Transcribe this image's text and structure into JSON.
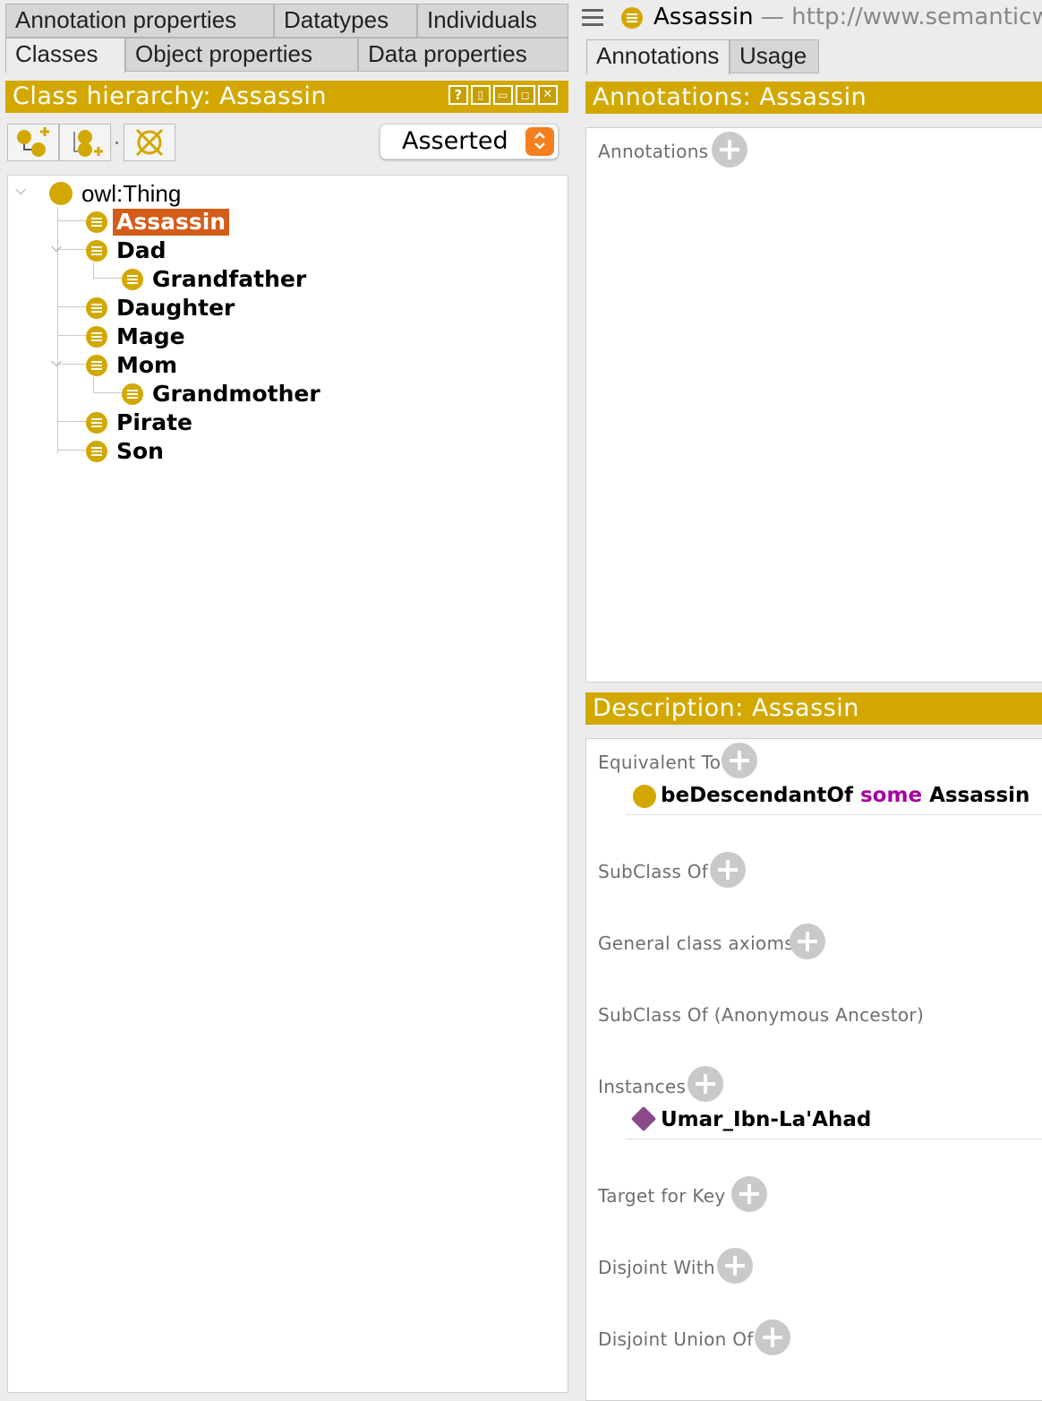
{
  "left_tabs": {
    "row1": [
      "Annotation properties",
      "Datatypes",
      "Individuals"
    ],
    "row2": [
      "Classes",
      "Object properties",
      "Data properties"
    ],
    "active": "Classes"
  },
  "class_hierarchy": {
    "title": "Class hierarchy: Assassin",
    "header_buttons": [
      "?",
      "▯",
      "▭",
      "◻",
      "✕"
    ],
    "mode_select": "Asserted",
    "tree": [
      {
        "label": "owl:Thing",
        "level": 0,
        "expanded": true
      },
      {
        "label": "Assassin",
        "level": 1,
        "selected": true
      },
      {
        "label": "Dad",
        "level": 1,
        "expanded": true
      },
      {
        "label": "Grandfather",
        "level": 2
      },
      {
        "label": "Daughter",
        "level": 1
      },
      {
        "label": "Mage",
        "level": 1
      },
      {
        "label": "Mom",
        "level": 1,
        "expanded": true
      },
      {
        "label": "Grandmother",
        "level": 2
      },
      {
        "label": "Pirate",
        "level": 1
      },
      {
        "label": "Son",
        "level": 1
      }
    ]
  },
  "entity_header": {
    "menu_icon": "hamburger-icon",
    "name": "Assassin",
    "iri": "— http://www.semanticw"
  },
  "right_tabs": [
    "Annotations",
    "Usage"
  ],
  "annotations_view": {
    "title": "Annotations: Assassin",
    "section": "Annotations"
  },
  "description_view": {
    "title": "Description: Assassin",
    "sections": {
      "equivalent_to": "Equivalent To",
      "subclass_of": "SubClass Of",
      "general_class_axioms": "General class axioms",
      "subclass_anon": "SubClass Of (Anonymous Ancestor)",
      "instances": "Instances",
      "target_for_key": "Target for Key",
      "disjoint_with": "Disjoint With",
      "disjoint_union_of": "Disjoint Union Of"
    },
    "equivalent_expr": {
      "property": "beDescendantOf",
      "keyword": "some",
      "filler": "Assassin"
    },
    "instance": "Umar_Ibn-La'Ahad"
  },
  "colors": {
    "header_gold": "#d2a800",
    "selection": "#d35c19",
    "keyword": "#a6009e",
    "individual": "#8a4a8a",
    "select_arrow": "#f57e1f"
  }
}
